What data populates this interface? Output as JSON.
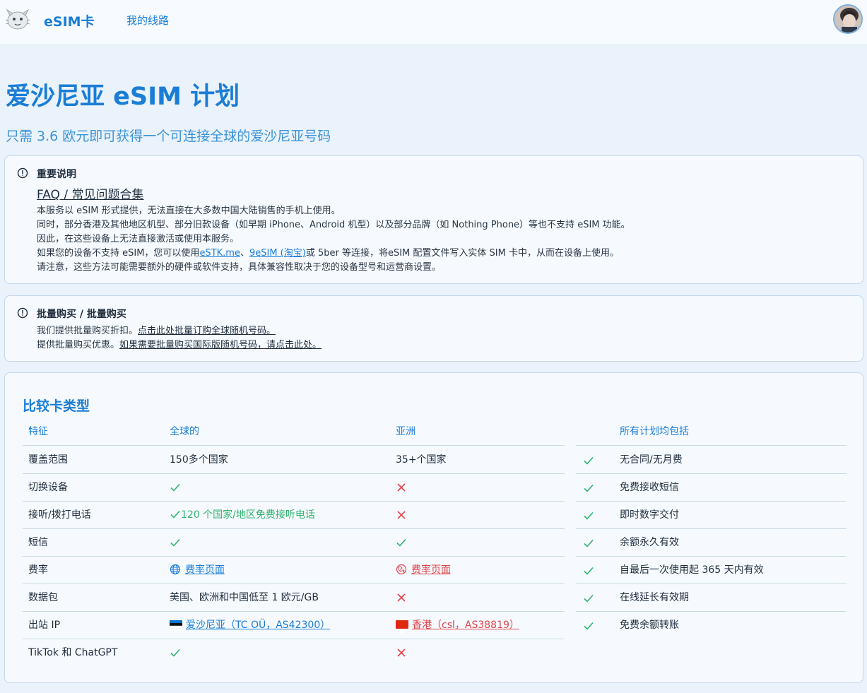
{
  "header": {
    "brand": "eSIM卡",
    "nav_routes": "我的线路"
  },
  "hero": {
    "title": "爱沙尼亚 eSIM 计划",
    "subtitle": "只需 3.6 欧元即可获得一个可连接全球的爱沙尼亚号码"
  },
  "notice_important": {
    "title": "重要说明",
    "faq_link": "FAQ / 常见问题合集",
    "line1": "本服务以 eSIM 形式提供，无法直接在大多数中国大陆销售的手机上使用。",
    "line2": "同时，部分香港及其他地区机型、部分旧款设备（如早期 iPhone、Android 机型）以及部分品牌（如 Nothing Phone）等也不支持 eSIM 功能。",
    "line3": "因此，在这些设备上无法直接激活或使用本服务。",
    "line4_pre": "如果您的设备不支持 eSIM，您可以使用",
    "line4_link1": "eSTK.me",
    "line4_sep": "、",
    "line4_link2": "9eSIM (淘宝)",
    "line4_post": "或 5ber 等连接，将eSIM 配置文件写入实体 SIM 卡中，从而在设备上使用。",
    "line5": "请注意，这些方法可能需要额外的硬件或软件支持，具体兼容性取决于您的设备型号和运营商设置。"
  },
  "notice_bulk": {
    "title": "批量购买 / 批量购买",
    "line1_pre": "我们提供批量购买折扣。",
    "line1_link": "点击此处批量订购全球随机号码。",
    "line2_pre": "提供批量购买优惠。",
    "line2_link": "如果需要批量购买国际版随机号码，请点击此处。"
  },
  "compare": {
    "title": "比较卡类型",
    "headers": {
      "feature": "特征",
      "global": "全球的",
      "asia": "亚洲",
      "included": "所有计划均包括"
    },
    "rows": [
      {
        "feature": "覆盖范围",
        "global": "150多个国家",
        "asia": "35+个国家"
      },
      {
        "feature": "切换设备",
        "global": "check",
        "asia": "cross"
      },
      {
        "feature": "接听/拨打电话",
        "global": "120 个国家/地区免费接听电话",
        "asia": "cross"
      },
      {
        "feature": "短信",
        "global": "check",
        "asia": "check"
      },
      {
        "feature": "费率",
        "global": "费率页面",
        "asia": "费率页面"
      },
      {
        "feature": "数据包",
        "global": "美国、欧洲和中国低至 1 欧元/GB",
        "asia": "cross"
      },
      {
        "feature": "出站 IP",
        "global": "爱沙尼亚（TC OÜ，AS42300）",
        "asia": "香港（csl，AS38819）"
      },
      {
        "feature": "TikTok 和 ChatGPT",
        "global": "check",
        "asia": "cross"
      }
    ],
    "included": [
      "无合同/无月费",
      "免费接收短信",
      "即时数字交付",
      "余额永久有效",
      "自最后一次使用起 365 天内有效",
      "在线延长有效期",
      "免费余额转账"
    ]
  },
  "colors": {
    "accent": "#1a7dd6",
    "check": "#2fb36c",
    "cross": "#e0454a",
    "page_bg": "#eaf2fb"
  }
}
